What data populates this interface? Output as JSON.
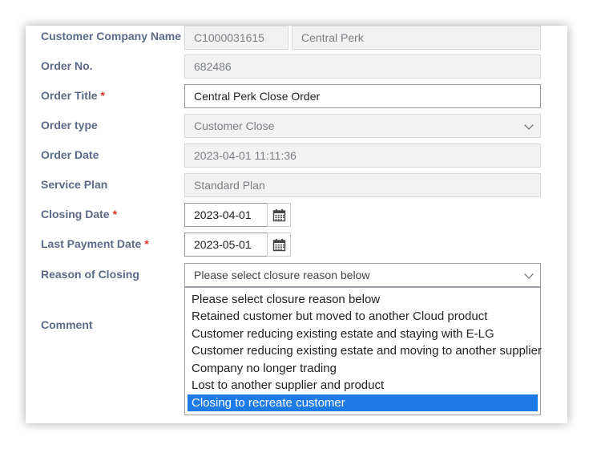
{
  "form": {
    "customer_company": {
      "label": "Customer Company Name",
      "code": "C1000031615",
      "name": "Central Perk"
    },
    "order_no": {
      "label": "Order No.",
      "value": "682486"
    },
    "order_title": {
      "label": "Order Title",
      "required_mark": "*",
      "value": "Central Perk Close Order"
    },
    "order_type": {
      "label": "Order type",
      "value": "Customer Close"
    },
    "order_date": {
      "label": "Order Date",
      "value": "2023-04-01 11:11:36"
    },
    "service_plan": {
      "label": "Service Plan",
      "value": "Standard Plan"
    },
    "closing_date": {
      "label": "Closing Date",
      "required_mark": "*",
      "value": "2023-04-01"
    },
    "last_payment_date": {
      "label": "Last Payment Date",
      "required_mark": "*",
      "value": "2023-05-01"
    },
    "reason_of_closing": {
      "label": "Reason of Closing",
      "value": "Please select closure reason below",
      "options": [
        "Please select closure reason below",
        "Retained customer but moved to another Cloud product",
        "Customer reducing existing estate and staying with E-LG",
        "Customer reducing existing estate and moving to another supplier",
        "Company no longer trading",
        "Lost to another supplier and product",
        "Closing to recreate customer"
      ],
      "highlighted_option": "Closing to recreate customer"
    },
    "comment": {
      "label": "Comment"
    }
  },
  "icons": {
    "calendar": "calendar-icon",
    "chevron": "chevron-down-icon"
  },
  "colors": {
    "label": "#5b6a86",
    "required": "#d9342b",
    "highlight": "#1e7ae6",
    "readonly_bg": "#f2f2f2"
  }
}
